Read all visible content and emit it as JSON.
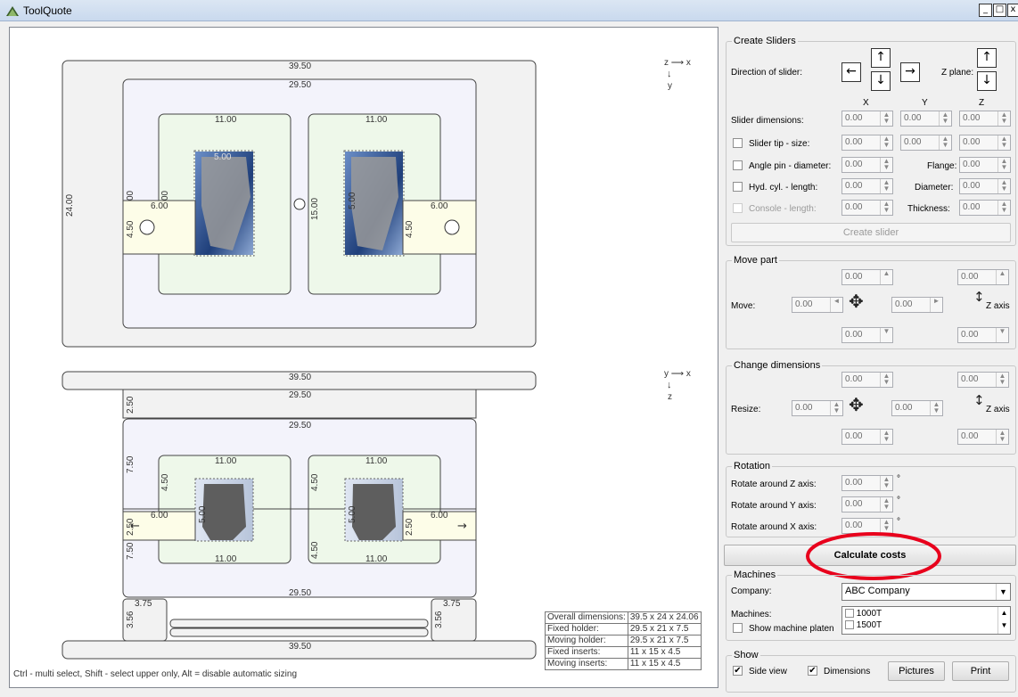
{
  "window": {
    "title": "ToolQuote",
    "min": "_",
    "max": "□",
    "close": "x"
  },
  "canvas": {
    "top_view": {
      "axis_h": "z ⟶ x",
      "axis_v": "y",
      "outer_w": "39.50",
      "holder_w": "29.50",
      "outer_h": "24.00",
      "insert_w_left": "11.00",
      "insert_w_right": "11.00",
      "insert_h": "15.00",
      "slider_left_len": "6.00",
      "slider_right_len": "6.00",
      "slider_left_w": "4.50",
      "slider_right_w": "4.50",
      "part_left_dim": "5.00",
      "part_right_dim": "5.00",
      "small_00": "00"
    },
    "side_view": {
      "axis_h": "y ⟶ x",
      "axis_v": "z",
      "plate_top": "39.50",
      "fixed_holder": "29.50",
      "fixed_h": "2.50",
      "moving_holder": "29.50",
      "moving_h_top": "7.50",
      "moving_h_bot": "7.50",
      "insert_left_top": "11.00",
      "insert_right_top": "11.00",
      "insert_left_bot": "11.00",
      "insert_right_bot": "11.00",
      "insert_h_left": "4.50",
      "insert_h_right": "4.50",
      "insert_h_left2": "4.50",
      "insert_h_right2": "4.50",
      "slider_left": "6.00",
      "slider_right": "6.00",
      "slider_h_left": "2.50",
      "slider_h_right": "2.50",
      "part_left": "5.00",
      "part_right": "5.00",
      "holder_bottom": "29.50",
      "riser_left_w": "3.75",
      "riser_right_w": "3.75",
      "riser_left_h": "3.56",
      "riser_right_h": "3.56",
      "plate_bottom": "39.50"
    },
    "summary": [
      {
        "label": "Overall dimensions:",
        "value": "39.5 x 24 x 24.06"
      },
      {
        "label": "Fixed holder:",
        "value": "29.5 x 21 x 7.5"
      },
      {
        "label": "Moving holder:",
        "value": "29.5 x 21 x 7.5"
      },
      {
        "label": "Fixed inserts:",
        "value": "11 x 15 x 4.5"
      },
      {
        "label": "Moving inserts:",
        "value": "11 x 15 x 4.5"
      }
    ],
    "hint": "Ctrl - multi select,  Shift - select upper only,  Alt = disable automatic sizing"
  },
  "sliders": {
    "title": "Create Sliders",
    "direction_label": "Direction of slider:",
    "zplane_label": "Z plane:",
    "col_x": "X",
    "col_y": "Y",
    "col_z": "Z",
    "dim_label": "Slider dimensions:",
    "tip_label": "Slider tip - size:",
    "angle_label": "Angle pin - diameter:",
    "hyd_label": "Hyd. cyl. - length:",
    "console_label": "Console - length:",
    "flange_label": "Flange:",
    "diameter_label": "Diameter:",
    "thickness_label": "Thickness:",
    "value": "0.00",
    "button": "Create slider"
  },
  "move": {
    "title": "Move part",
    "label": "Move:",
    "z_axis": "Z axis",
    "value": "0.00"
  },
  "change": {
    "title": "Change dimensions",
    "label": "Resize:",
    "z_axis": "Z axis",
    "value": "0.00"
  },
  "rotation": {
    "title": "Rotation",
    "z": "Rotate around Z axis:",
    "y": "Rotate around Y axis:",
    "x": "Rotate around X axis:",
    "value": "0.00",
    "deg": "°"
  },
  "calc": {
    "label": "Calculate costs"
  },
  "machines": {
    "title": "Machines",
    "company_label": "Company:",
    "company": "ABC Company",
    "machines_label": "Machines:",
    "list": [
      "1000T",
      "1500T"
    ],
    "platen_label": "Show machine platen"
  },
  "show": {
    "title": "Show",
    "side": "Side view",
    "dims": "Dimensions",
    "pictures": "Pictures",
    "print": "Print",
    "check": "✔"
  },
  "colors": {
    "highlight": "#e8001c"
  }
}
